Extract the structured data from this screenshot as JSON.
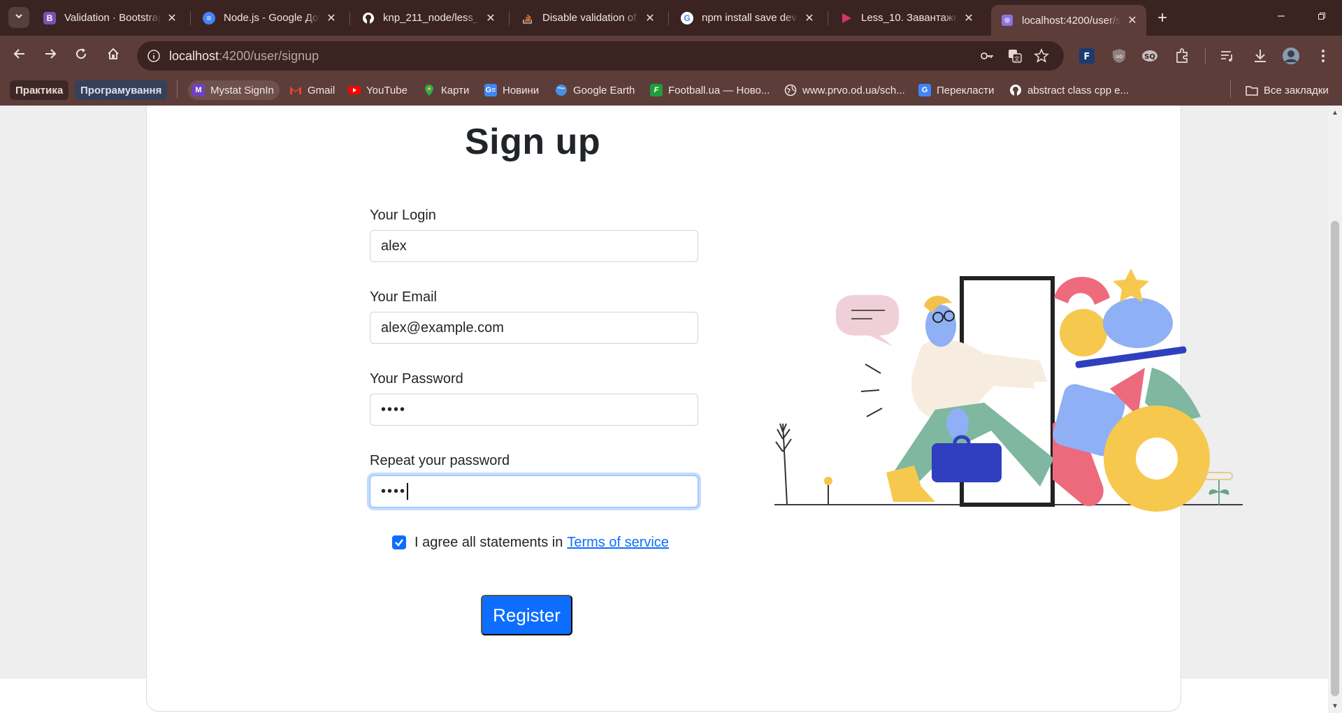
{
  "browser": {
    "tabs": [
      {
        "title": "Validation · Bootstrap",
        "favicon": "bootstrap-icon",
        "fav_letter": "B",
        "color": "#7952b3"
      },
      {
        "title": "Node.js - Google Док",
        "favicon": "google-docs-icon",
        "fav_letter": "≡",
        "color": "#4285f4"
      },
      {
        "title": "knp_211_node/less_9",
        "favicon": "github-icon",
        "fav_letter": "",
        "color": "#ffffff"
      },
      {
        "title": "Disable validation of",
        "favicon": "stackoverflow-icon",
        "fav_letter": "",
        "color": "#f48024"
      },
      {
        "title": "npm install save dev",
        "favicon": "google-icon",
        "fav_letter": "G",
        "color": "#ffffff"
      },
      {
        "title": "Less_10. Завантажен",
        "favicon": "media-icon",
        "fav_letter": "",
        "color": "#d6336c"
      },
      {
        "title": "localhost:4200/user/s",
        "favicon": "angular-icon",
        "fav_letter": "",
        "color": "#c3b5f5"
      }
    ],
    "url": {
      "host": "localhost",
      "path": ":4200/user/signup"
    },
    "bookmarks": [
      {
        "label": "Практика",
        "type": "folder-chip"
      },
      {
        "label": "Програмування",
        "type": "folder-chip-blue"
      },
      {
        "label": "Mystat SignIn",
        "icon": "mystat-icon"
      },
      {
        "label": "Gmail",
        "icon": "gmail-icon"
      },
      {
        "label": "YouTube",
        "icon": "youtube-icon"
      },
      {
        "label": "Карти",
        "icon": "maps-icon"
      },
      {
        "label": "Новини",
        "icon": "news-icon"
      },
      {
        "label": "Google Earth",
        "icon": "earth-icon"
      },
      {
        "label": "Football.ua — Ново...",
        "icon": "football-icon"
      },
      {
        "label": "www.prvo.od.ua/sch...",
        "icon": "globe-icon"
      },
      {
        "label": "Перекласти",
        "icon": "translate-icon"
      },
      {
        "label": "abstract class cpp e...",
        "icon": "github-icon"
      }
    ],
    "all_bookmarks": "Все закладки"
  },
  "form": {
    "heading": "Sign up",
    "login": {
      "label": "Your Login",
      "value": "alex"
    },
    "email": {
      "label": "Your Email",
      "value": "alex@example.com"
    },
    "password": {
      "label": "Your Password",
      "value": "••••"
    },
    "repeat_password": {
      "label": "Repeat your password",
      "value": "••••"
    },
    "agree": {
      "text": "I agree all statements in",
      "link": "Terms of service",
      "checked": true
    },
    "submit_label": "Register"
  },
  "colors": {
    "primary": "#0d6efd",
    "chrome_dark": "#3b2322",
    "chrome": "#5c3d3a"
  }
}
